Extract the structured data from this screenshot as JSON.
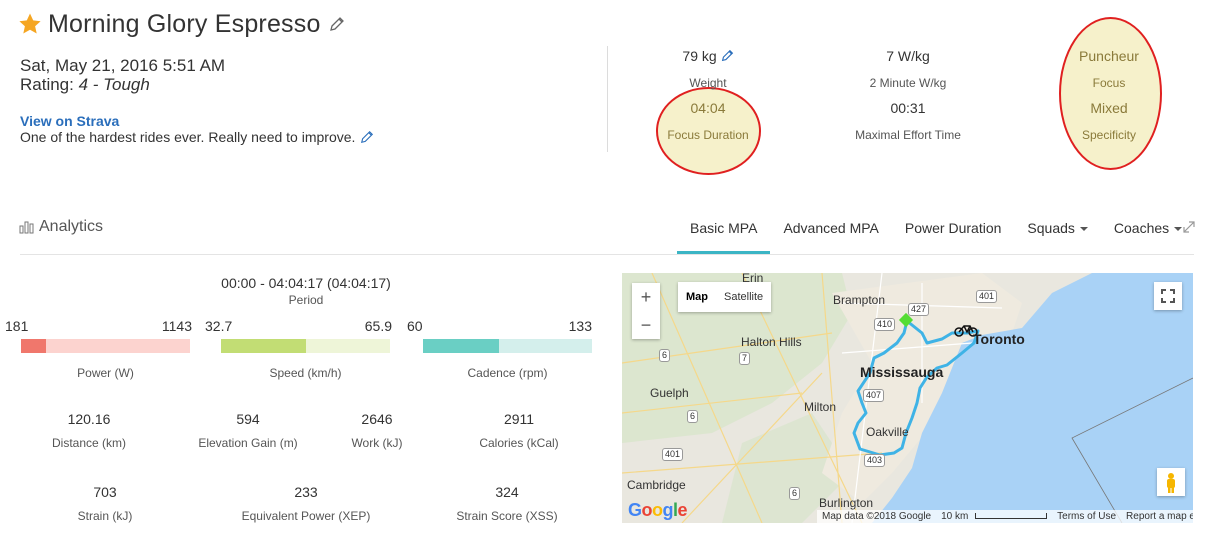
{
  "header": {
    "title": "Morning Glory Espresso",
    "date": "Sat, May 21, 2016 5:51 AM",
    "rating_prefix": "Rating:",
    "rating_value": "4 - Tough",
    "strava_link": "View on Strava",
    "description": "One of the hardest rides ever. Really need to improve."
  },
  "metrics": {
    "weight": {
      "value": "79 kg",
      "label": "Weight"
    },
    "wkg": {
      "value": "7 W/kg",
      "label": "2 Minute W/kg"
    },
    "focus": {
      "value": "Puncheur",
      "label": "Focus"
    },
    "focus_duration": {
      "value": "04:04",
      "label": "Focus Duration"
    },
    "max_effort": {
      "value": "00:31",
      "label": "Maximal Effort Time"
    },
    "specificity": {
      "value": "Mixed",
      "label": "Specificity"
    }
  },
  "analytics": {
    "title": "Analytics",
    "tabs": [
      {
        "label": "Basic MPA",
        "active": true
      },
      {
        "label": "Advanced MPA"
      },
      {
        "label": "Power Duration"
      },
      {
        "label": "Squads",
        "dropdown": true
      },
      {
        "label": "Coaches",
        "dropdown": true
      }
    ]
  },
  "period": {
    "value": "00:00 - 04:04:17 (04:04:17)",
    "label": "Period"
  },
  "ranges": {
    "power": {
      "min": "181",
      "max": "1143",
      "label": "Power (W)",
      "fraction": 0.15,
      "color": "#f0776c",
      "track": "#fcd3cf"
    },
    "speed": {
      "min": "32.7",
      "max": "65.9",
      "label": "Speed (km/h)",
      "fraction": 0.5,
      "color": "#c2dd74",
      "track": "#eef5d8"
    },
    "cadence": {
      "min": "60",
      "max": "133",
      "label": "Cadence (rpm)",
      "fraction": 0.45,
      "color": "#6acfc4",
      "track": "#d4efec"
    }
  },
  "stats": {
    "distance": {
      "value": "120.16",
      "label": "Distance (km)"
    },
    "elevation": {
      "value": "594",
      "label": "Elevation Gain (m)"
    },
    "work": {
      "value": "2646",
      "label": "Work (kJ)"
    },
    "calories": {
      "value": "2911",
      "label": "Calories (kCal)"
    },
    "strain": {
      "value": "703",
      "label": "Strain (kJ)"
    },
    "xep": {
      "value": "233",
      "label": "Equivalent Power (XEP)"
    },
    "xss": {
      "value": "324",
      "label": "Strain Score (XSS)"
    }
  },
  "map": {
    "map_btn": "Map",
    "satellite_btn": "Satellite",
    "zoom_in": "+",
    "zoom_out": "−",
    "google": "Google",
    "attribution": "Map data ©2018 Google",
    "scale": "10 km",
    "terms": "Terms of Use",
    "report": "Report a map error",
    "labels": {
      "erin": "Erin",
      "brampton": "Brampton",
      "halton_hills": "Halton Hills",
      "toronto": "Toronto",
      "mississauga": "Mississauga",
      "guelph": "Guelph",
      "milton": "Milton",
      "oakville": "Oakville",
      "cambridge": "Cambridge",
      "burlington": "Burlington",
      "h427": "427",
      "h401a": "401",
      "h410": "410",
      "h407": "407",
      "h403": "403",
      "h401b": "401",
      "h6a": "6",
      "h6b": "6",
      "h6c": "6",
      "h7": "7"
    }
  },
  "colors": {
    "accent": "#3bb5c5",
    "link": "#2a6ebb",
    "highlight_circle": "#e02020",
    "route": "#3fb3e6",
    "star": "#f5a623"
  }
}
